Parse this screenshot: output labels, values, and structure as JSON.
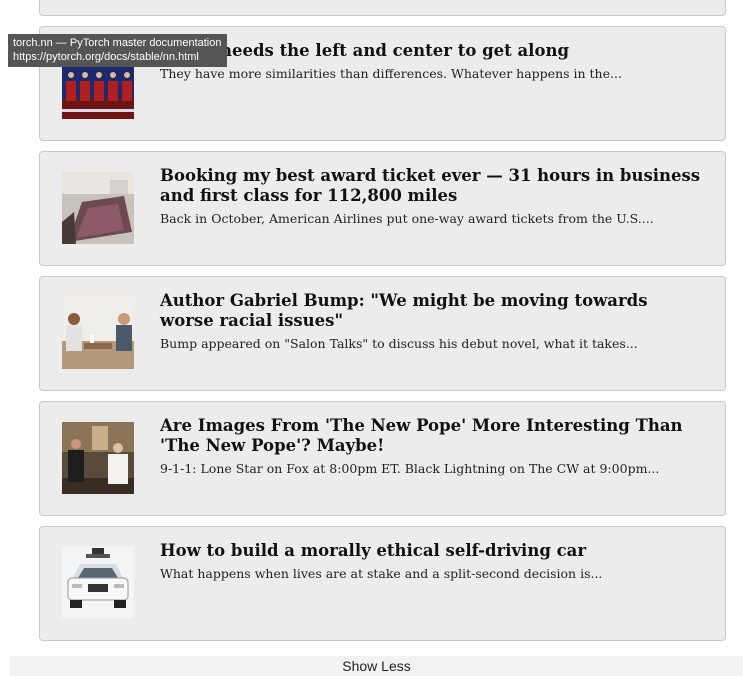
{
  "tooltip": {
    "title": "torch.nn — PyTorch master documentation",
    "url": "https://pytorch.org/docs/stable/nn.html"
  },
  "articles": [
    {
      "title": "needs the left and center to get along",
      "snippet": "They have more similarities than differences. Whatever happens in the...",
      "image": "debate-stage-image"
    },
    {
      "title": "Booking my best award ticket ever — 31 hours in business and first class for 112,800 miles",
      "snippet": "Back in October, American Airlines put one-way award tickets from the U.S....",
      "image": "airline-seat-image"
    },
    {
      "title": "Author Gabriel Bump: \"We might be moving towards worse racial issues\"",
      "snippet": "Bump appeared on \"Salon Talks\" to discuss his debut novel, what it takes...",
      "image": "interview-image"
    },
    {
      "title": "Are Images From 'The New Pope' More Interesting Than 'The New Pope'? Maybe!",
      "snippet": "9-1-1: Lone Star on Fox at 8:00pm ET. Black Lightning on The CW at 9:00pm...",
      "image": "new-pope-scene-image"
    },
    {
      "title": "How to build a morally ethical self-driving car",
      "snippet": "What happens when lives are at stake and a split-second decision is...",
      "image": "self-driving-car-image"
    }
  ],
  "footer": {
    "show_less_label": "Show Less"
  }
}
